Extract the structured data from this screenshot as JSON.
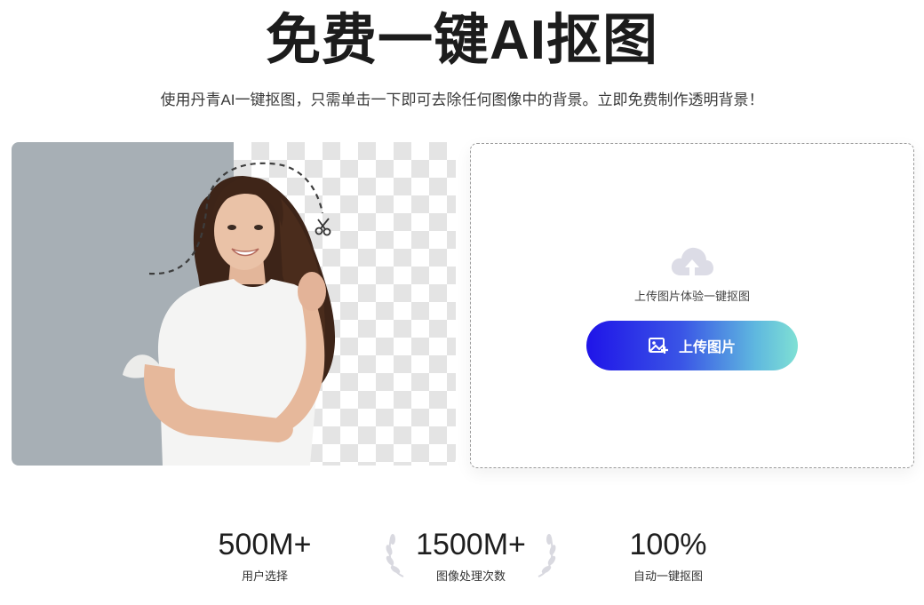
{
  "hero": {
    "title": "免费一键AI抠图",
    "subtitle": "使用丹青AI一键抠图，只需单击一下即可去除任何图像中的背景。立即免费制作透明背景！"
  },
  "demo": {
    "image_alt": "portrait-woman-white-tshirt",
    "scissors_icon": "scissors-icon"
  },
  "upload": {
    "hint": "上传图片体验一键抠图",
    "button_label": "上传图片",
    "cloud_icon": "cloud-upload-icon",
    "button_icon": "image-add-icon",
    "gradient": [
      "#1f14e8",
      "#7fe0d4"
    ]
  },
  "stats": [
    {
      "value": "500M+",
      "label": "用户选择"
    },
    {
      "value": "1500M+",
      "label": "图像处理次数"
    },
    {
      "value": "100%",
      "label": "自动一键抠图"
    }
  ],
  "colors": {
    "gray_backdrop": "#a7afb5",
    "title": "#1c1c1c"
  }
}
